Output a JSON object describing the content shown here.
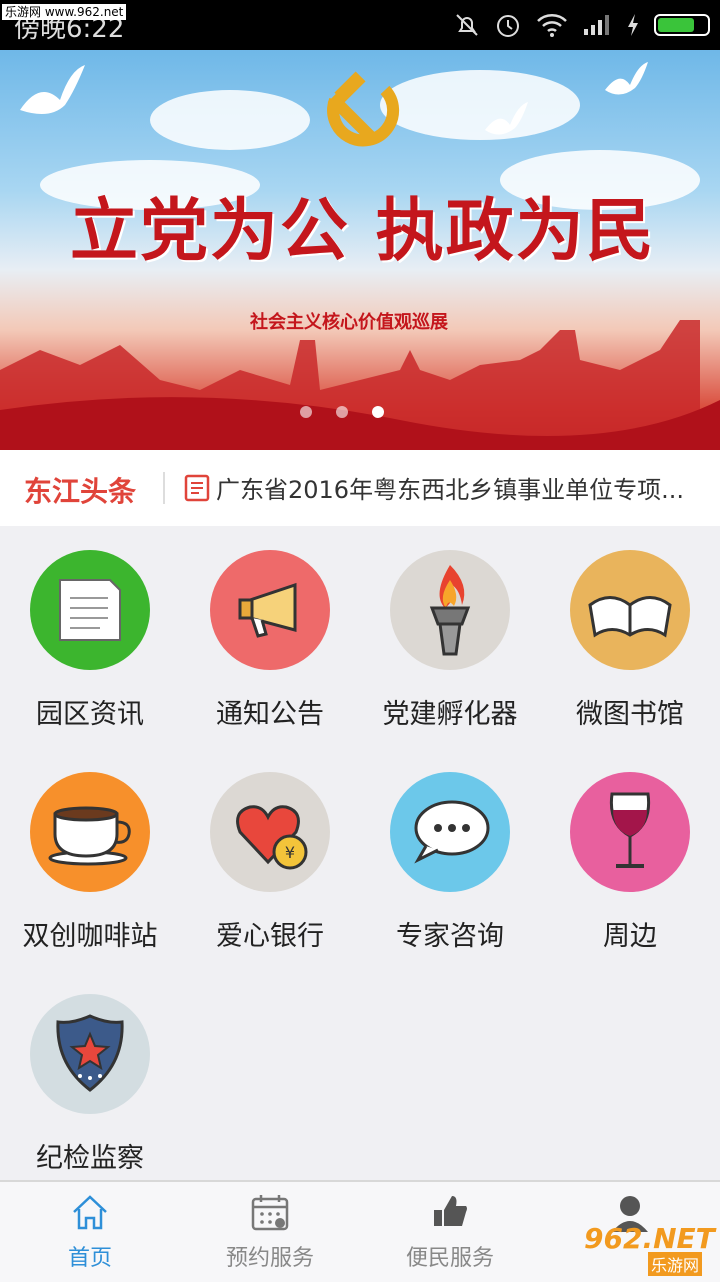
{
  "status_bar": {
    "time": "傍晚6:22",
    "watermark": "乐游网 www.962.net"
  },
  "banner": {
    "title": "立党为公 执政为民",
    "subtitle": "社会主义核心价值观巡展",
    "page_indicator_count": 3,
    "active_index": 2
  },
  "headline": {
    "label": "东江头条",
    "text": "广东省2016年粤东西北乡镇事业单位专项..."
  },
  "grid": [
    {
      "label": "园区资讯",
      "icon": "document-icon",
      "color": "#3cb52e"
    },
    {
      "label": "通知公告",
      "icon": "megaphone-icon",
      "color": "#ee6a6a"
    },
    {
      "label": "党建孵化器",
      "icon": "torch-icon",
      "color": "#dcd8d3"
    },
    {
      "label": "微图书馆",
      "icon": "book-icon",
      "color": "#e9b45c"
    },
    {
      "label": "双创咖啡站",
      "icon": "coffee-cup-icon",
      "color": "#f7902b"
    },
    {
      "label": "爱心银行",
      "icon": "heart-coin-icon",
      "color": "#dcd8d3"
    },
    {
      "label": "专家咨询",
      "icon": "chat-bubble-icon",
      "color": "#6cc8ea"
    },
    {
      "label": "周边",
      "icon": "wine-glass-icon",
      "color": "#e8609e"
    },
    {
      "label": "纪检监察",
      "icon": "police-badge-icon",
      "color": "#d3dde1"
    }
  ],
  "tabs": [
    {
      "label": "首页",
      "icon": "home-icon",
      "active": true
    },
    {
      "label": "预约服务",
      "icon": "calendar-icon",
      "active": false
    },
    {
      "label": "便民服务",
      "icon": "thumbs-up-icon",
      "active": false
    },
    {
      "label": "",
      "icon": "user-icon",
      "active": false
    }
  ],
  "watermark_bottom": {
    "brand": "962.NET",
    "site": "乐游网"
  },
  "colors": {
    "accent": "#2e8fd8",
    "headline_red": "#e0443a"
  }
}
